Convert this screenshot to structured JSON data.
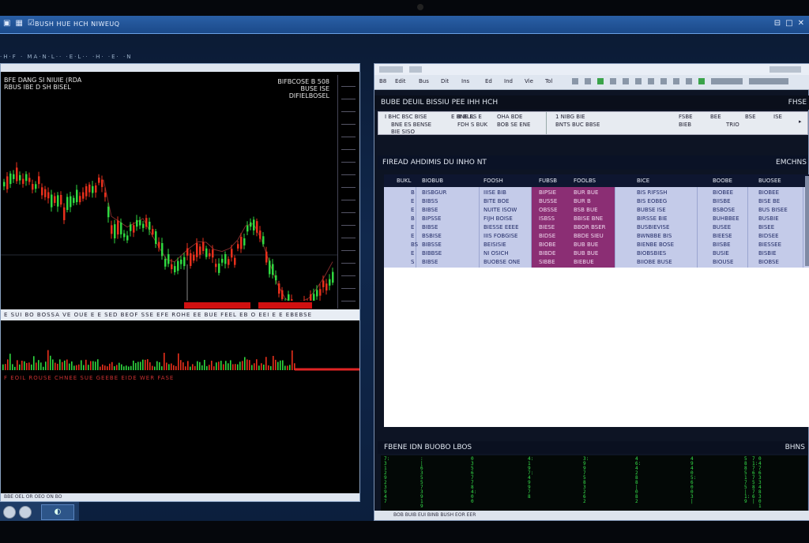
{
  "topbar": {
    "label": "BUSH HUE HCH NIWEUQ",
    "icons": [
      "window-icon",
      "grid-icon",
      "check-icon"
    ],
    "controls": [
      "⊟",
      "□",
      "✕"
    ]
  },
  "status_line": "·H·F · MA·N·L·· ·E·L·· ·H· ·E· ·N",
  "left_chart": {
    "title_left_1": "BFE DANG SI NIUIE (RDA",
    "title_left_2": "RBUS IBE D SH BISEL",
    "title_right_1": "BIFBCOSE B 508",
    "title_right_2": "BUSE ISE",
    "title_right_3": "DIFIELBOSEL",
    "sep_text": "E SUI BO BOSSA VE OUE E E SED BEOF SSE EFE ROHE EE BUE FEEL EB O EEI E E EBEBSE",
    "red_label": "F EOIL ROUSE CHNEE SUE  GEEBE EIDE WER  FASE",
    "bottom_text": "BBE OEL OR  OEO ON BO",
    "colors": {
      "up": "#2fd840",
      "down": "#e8301c",
      "ma": "#7a2a2a",
      "volume_line": "#e02424"
    }
  },
  "right_window": {
    "toolbar_items": [
      "B8",
      "Edit",
      "Bus",
      "Dit",
      "Ins",
      "Ed",
      "Ind",
      "Vie",
      "Tol"
    ],
    "section_title": "BUBE DEUIL BISSIU PEE IHH HCH",
    "section_title_right": "FHSE",
    "info_left": [
      "I BHC BSC BISE",
      "BNE ES BENSE",
      "E BNE ES E",
      "BIE SISO"
    ],
    "info_mid": [
      "B BLIL",
      "FDH S BUK",
      "OHA BDE",
      "BOB SE ENE"
    ],
    "info_mid2": [
      "1 NIBG BIE",
      "BNTS BUC  BBSE"
    ],
    "info_right": [
      "FSBE",
      "BIEB",
      "BEE",
      "BSE",
      "ISE",
      "TRIO"
    ],
    "grid_title": "FIREAD AHDIMIS DU INHO NT",
    "grid_title_right": "EMCHNS",
    "columns": [
      "BUKL",
      "BIOBUB",
      "FOOSH",
      "FUBSB",
      "FOOLBS",
      "BICE",
      "BOOBE",
      "BUOSEE"
    ],
    "rows": [
      [
        "B",
        "BISBGUR",
        "IIISE BIB",
        "BIPSIE",
        "BUR BUE",
        "BIS RIFSSH",
        "BIOBEE",
        "BIOBEE"
      ],
      [
        "E",
        "BIBSS",
        "BITE BOE",
        "BUSSE",
        "BUR B",
        "BIS EOBEG",
        "BIISBE",
        "BISE BE"
      ],
      [
        "E",
        "BIBSE",
        "NUITE ISOW",
        "OBSSE",
        "BSB BUE",
        "BUBSE ISE",
        "BSBOSE",
        "BUS BISEE"
      ],
      [
        "B",
        "BIPSSE",
        "FIJH BOISE",
        "ISBSS",
        "BBISE BNE",
        "BIRSSE BIE",
        "BUHBBEE",
        "BUSBIE"
      ],
      [
        "E",
        "BIBSE",
        "BIESSE EEEE",
        "BIESE",
        "BBOR BSER",
        "BUSBIEVISE",
        "BUSEE",
        "BISEE"
      ],
      [
        "E",
        "BSBISE",
        "IIIS FOBGISE",
        "BIDSE",
        "BBDE SIEU",
        "BWNBBE BIS",
        "BIEESE",
        "BIDSEE"
      ],
      [
        "BS",
        "BIBSSE",
        "BEISISIE",
        "BIOBE",
        "BUB BUE",
        "BIENBE BOSE",
        "BIISBE",
        "BIESSEE"
      ],
      [
        "E",
        "BIBBSE",
        "NI OSICH",
        "BIBDE",
        "BUB BUE",
        "BIOBSBIES",
        "BUSIE",
        "BISBIE"
      ],
      [
        "S",
        "BIBSE",
        "BUOBSE ONE",
        "SIBBE",
        "BIEBUE",
        "BIIOBE BUSE",
        "BIOUSE",
        "BIOBSE"
      ]
    ],
    "lower_title": "FBENE IDN BUOBO LBOS",
    "lower_title_right": "BHNS",
    "status_text": "BOB  BUIB  EUI  BINB  BUSH  EOR  EER"
  },
  "taskbar": {
    "button_icon": "◐"
  }
}
